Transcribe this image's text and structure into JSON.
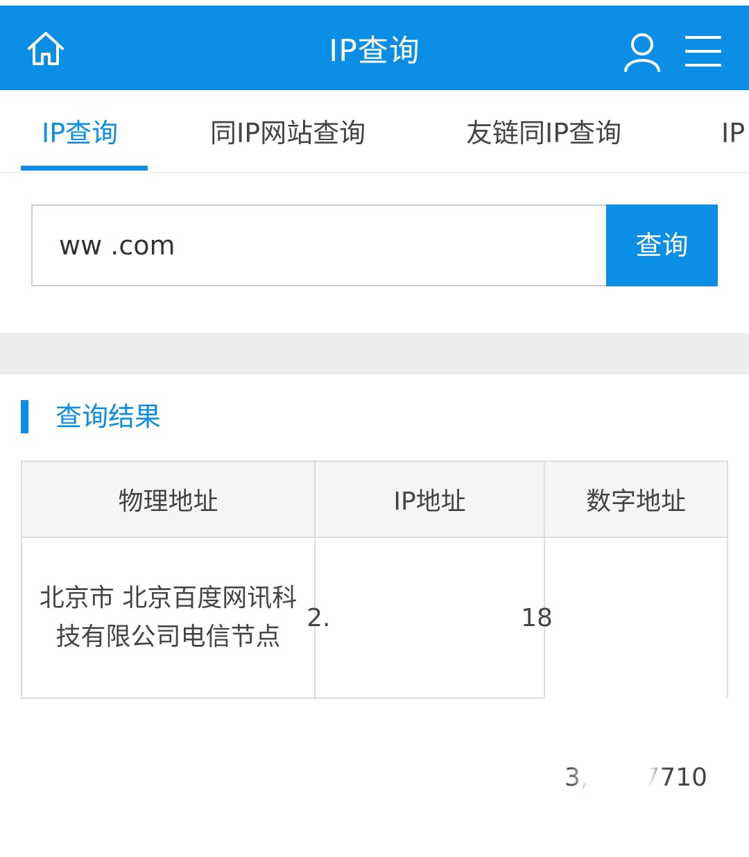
{
  "header": {
    "title": "IP查询",
    "icons": [
      "home-icon",
      "user-icon",
      "menu-icon"
    ],
    "accent_color": "#0b8ee6"
  },
  "tabs": [
    {
      "label": "IP查询",
      "active": true
    },
    {
      "label": "同IP网站查询",
      "active": false
    },
    {
      "label": "友链同IP查询",
      "active": false
    },
    {
      "label": "IP",
      "active": false
    }
  ],
  "search": {
    "value": "ww                      .com",
    "button_label": "查询"
  },
  "results": {
    "section_title": "查询结果",
    "columns": [
      "物理地址",
      "IP地址",
      "数字地址"
    ],
    "rows": [
      {
        "physical": "北京市 北京百度网讯科技有限公司电信节点",
        "ip": "2.                        18",
        "numeric": "3,       7710"
      }
    ]
  }
}
